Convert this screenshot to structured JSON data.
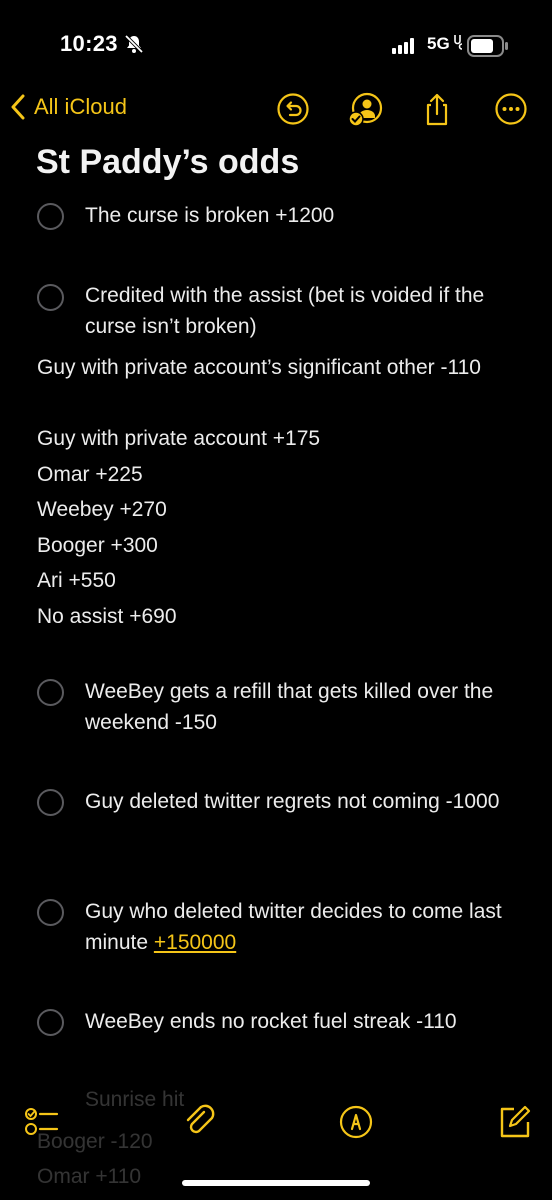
{
  "status_bar": {
    "time": "10:23",
    "network": "5G"
  },
  "nav": {
    "back_label": "All iCloud"
  },
  "note": {
    "title": "St Paddy’s odds",
    "checklist_top": [
      {
        "text": "The curse is broken +1200"
      },
      {
        "text": "Credited with the assist (bet is voided if the curse isn’t broken)"
      }
    ],
    "assist_lines": [
      "Guy with private account’s significant other -110",
      "Guy with private account +175",
      "Omar +225",
      "Weebey +270",
      "Booger +300",
      "Ari +550",
      "No assist +690"
    ],
    "checklist_bottom": [
      {
        "text": "WeeBey gets a refill that gets killed over the weekend -150"
      },
      {
        "text": "Guy deleted twitter regrets not coming -1000"
      },
      {
        "text_before": "Guy who deleted twitter decides to come last minute ",
        "link": "+150000"
      },
      {
        "text": "WeeBey ends no rocket fuel streak -110"
      }
    ],
    "faded_lines": [
      "Sunrise hit",
      "Booger -120",
      "Omar +110"
    ]
  },
  "colors": {
    "accent": "#f5c518",
    "background": "#000000",
    "text": "#ececec"
  },
  "icons": {
    "nav": [
      "undo-icon",
      "share-person-icon",
      "share-icon",
      "more-icon"
    ],
    "toolbar": [
      "checklist-icon",
      "attachment-icon",
      "markup-icon",
      "compose-icon"
    ]
  }
}
